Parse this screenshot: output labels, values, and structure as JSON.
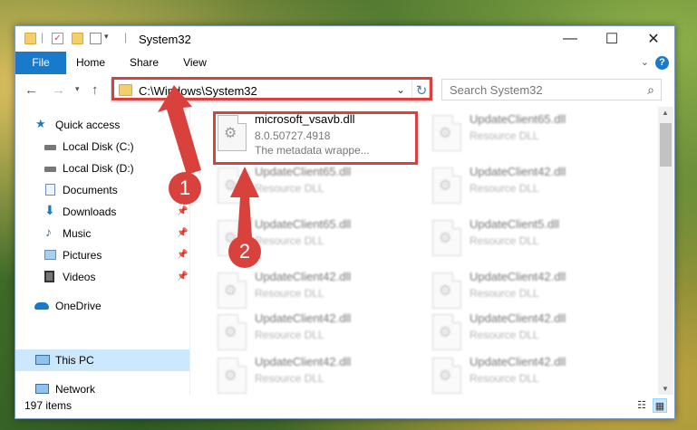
{
  "window": {
    "title": "System32",
    "controls": {
      "minimize": "—",
      "maximize": "☐",
      "close": "✕"
    }
  },
  "ribbon": {
    "tabs": [
      "File",
      "Home",
      "Share",
      "View"
    ],
    "help": "?"
  },
  "nav": {
    "address": "C:\\Windows\\System32",
    "search_placeholder": "Search System32"
  },
  "sidebar": {
    "items": [
      {
        "label": "Quick access",
        "icon": "star-icon",
        "pinned": false
      },
      {
        "label": "Local Disk (C:)",
        "icon": "drive-icon",
        "pinned": true
      },
      {
        "label": "Local Disk (D:)",
        "icon": "drive-icon",
        "pinned": false
      },
      {
        "label": "Documents",
        "icon": "documents-icon",
        "pinned": true
      },
      {
        "label": "Downloads",
        "icon": "download-icon",
        "pinned": true
      },
      {
        "label": "Music",
        "icon": "music-icon",
        "pinned": true
      },
      {
        "label": "Pictures",
        "icon": "pictures-icon",
        "pinned": true
      },
      {
        "label": "Videos",
        "icon": "videos-icon",
        "pinned": true
      },
      {
        "label": "OneDrive",
        "icon": "onedrive-icon",
        "pinned": false
      },
      {
        "label": "This PC",
        "icon": "pc-icon",
        "pinned": false,
        "selected": true
      },
      {
        "label": "Network",
        "icon": "network-icon",
        "pinned": false
      }
    ]
  },
  "files": {
    "highlighted": {
      "name": "microsoft_vsavb.dll",
      "line2": "8.0.50727.4918",
      "line3": "The metadata wrappe..."
    },
    "left_column": [
      {
        "name": "UpdateClient65.dll",
        "type": "Resource DLL"
      },
      {
        "name": "UpdateClient65.dll",
        "type": "Resource DLL"
      },
      {
        "name": "UpdateClient42.dll",
        "type": "Resource DLL"
      },
      {
        "name": "UpdateClient42.dll",
        "type": "Resource DLL"
      },
      {
        "name": "UpdateClient42.dll",
        "type": "Resource DLL"
      }
    ],
    "right_column": [
      {
        "name": "UpdateClient65.dll",
        "type": "Resource DLL"
      },
      {
        "name": "UpdateClient42.dll",
        "type": "Resource DLL"
      },
      {
        "name": "UpdateClient5.dll",
        "type": "Resource DLL"
      },
      {
        "name": "UpdateClient42.dll",
        "type": "Resource DLL"
      },
      {
        "name": "UpdateClient42.dll",
        "type": "Resource DLL"
      },
      {
        "name": "UpdateClient42.dll",
        "type": "Resource DLL"
      }
    ]
  },
  "status": {
    "count": "197 items"
  },
  "callouts": [
    "1",
    "2"
  ],
  "colors": {
    "accent": "#1979ca",
    "highlight": "#d9413c",
    "selection": "#cce8ff"
  }
}
